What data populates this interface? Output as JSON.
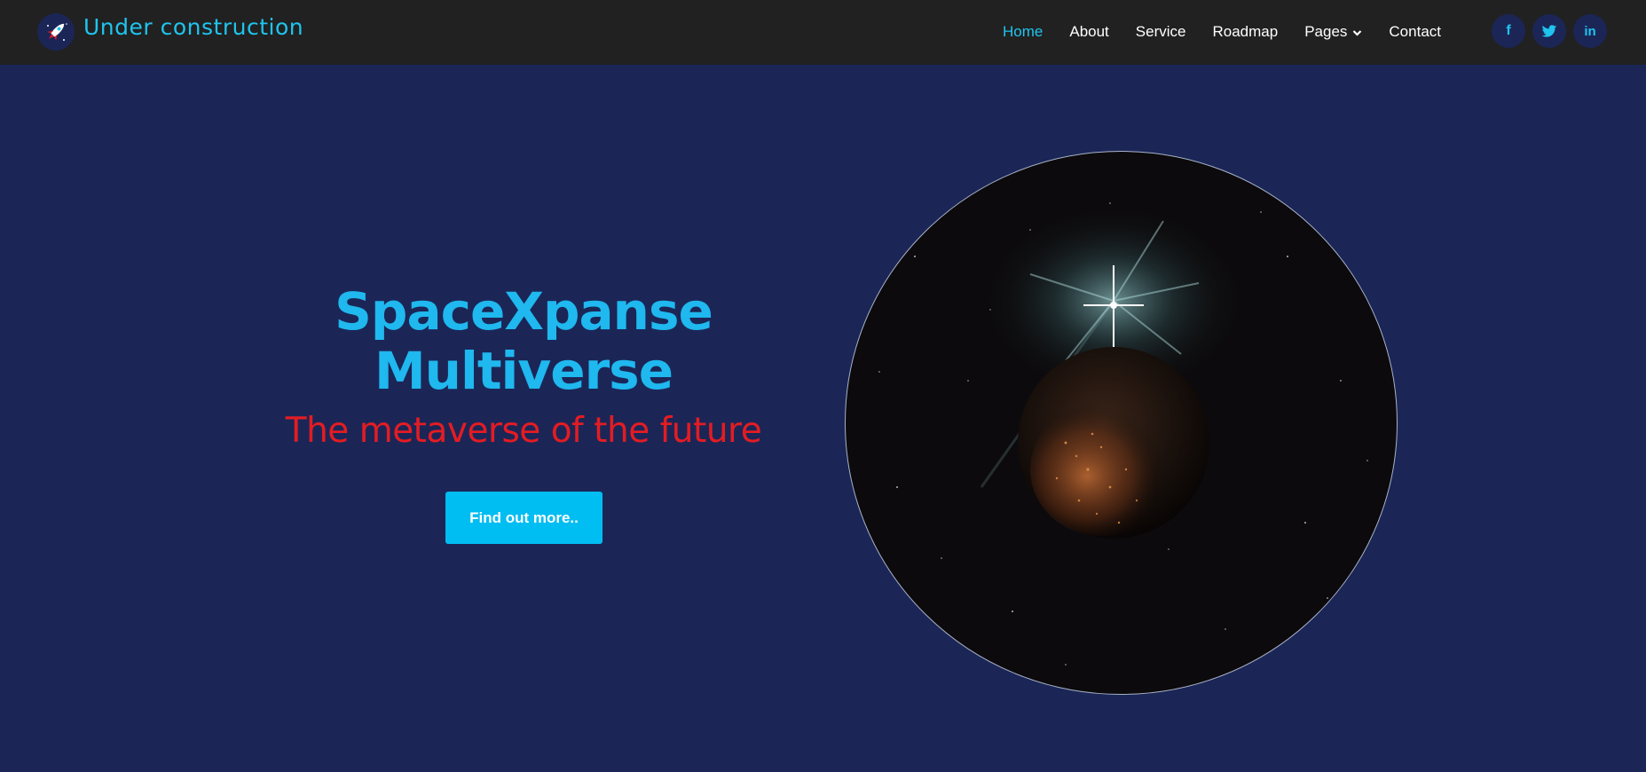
{
  "header": {
    "brand": "Under construction",
    "logo_icon": "rocket-icon",
    "nav": [
      {
        "label": "Home",
        "active": true
      },
      {
        "label": "About"
      },
      {
        "label": "Service"
      },
      {
        "label": "Roadmap"
      },
      {
        "label": "Pages",
        "has_dropdown": true
      },
      {
        "label": "Contact"
      }
    ],
    "social": [
      {
        "icon": "facebook-icon",
        "glyph": "f"
      },
      {
        "icon": "twitter-icon",
        "glyph": "t"
      },
      {
        "icon": "linkedin-icon",
        "glyph": "in"
      }
    ]
  },
  "hero": {
    "title_line1": "SpaceXpanse",
    "title_line2": "Multiverse",
    "subtitle": "The metaverse of the future",
    "cta_label": "Find out more.."
  },
  "colors": {
    "background": "#1b2657",
    "navbar": "#212121",
    "accent": "#1fc4ee",
    "title": "#1fb8ef",
    "subtitle": "#e31c23",
    "button": "#00bdf2"
  }
}
